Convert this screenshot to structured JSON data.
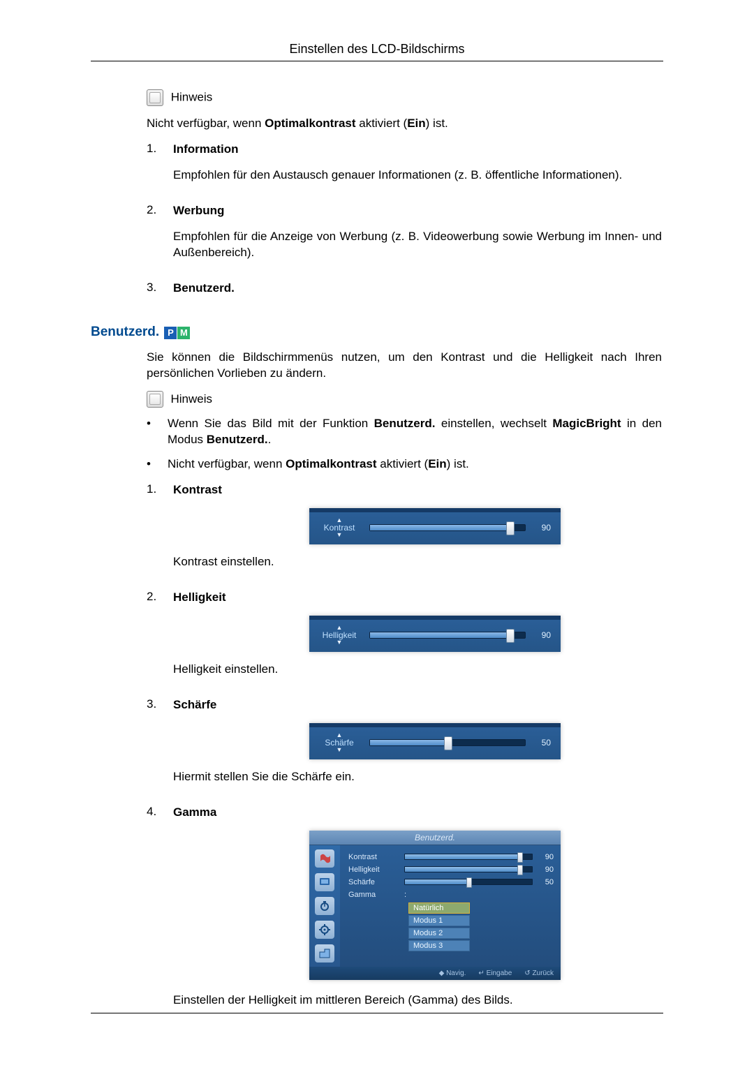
{
  "header": {
    "title": "Einstellen des LCD-Bildschirms"
  },
  "hinweis_label": "Hinweis",
  "top_note_text_pre": "Nicht verfügbar, wenn ",
  "top_note_bold1": "Optimalkontrast",
  "top_note_text_mid": " aktiviert (",
  "top_note_bold2": "Ein",
  "top_note_text_end": ") ist.",
  "top_list": {
    "i1": {
      "num": "1.",
      "title": "Information",
      "desc": "Empfohlen für den Austausch genauer Informationen (z. B. öffentliche Informationen)."
    },
    "i2": {
      "num": "2.",
      "title": "Werbung",
      "desc": "Empfohlen für die Anzeige von Werbung (z. B. Videowerbung sowie Werbung im Innen- und Außenbereich)."
    },
    "i3": {
      "num": "3.",
      "title": "Benutzerd."
    }
  },
  "section": {
    "title": "Benutzerd.",
    "intro": "Sie können die Bildschirmmenüs nutzen, um den Kontrast und die Helligkeit nach Ihren persönlichen Vorlieben zu ändern.",
    "bullet1_pre": "Wenn Sie das Bild mit der Funktion ",
    "bullet1_b1": "Benutzerd.",
    "bullet1_mid": " einstellen, wechselt ",
    "bullet1_b2": "MagicBright",
    "bullet1_mid2": " in den Modus ",
    "bullet1_b3": "Benutzerd.",
    "bullet1_end": ".",
    "bullet2_pre": "Nicht verfügbar, wenn ",
    "bullet2_b1": "Optimalkontrast",
    "bullet2_mid": " aktiviert (",
    "bullet2_b2": "Ein",
    "bullet2_end": ") ist.",
    "items": {
      "kontrast": {
        "num": "1.",
        "title": "Kontrast",
        "slider_label": "Kontrast",
        "value": "90",
        "pct": 90,
        "desc": "Kontrast einstellen."
      },
      "helligkeit": {
        "num": "2.",
        "title": "Helligkeit",
        "slider_label": "Helligkeit",
        "value": "90",
        "pct": 90,
        "desc": "Helligkeit einstellen."
      },
      "schaerfe": {
        "num": "3.",
        "title": "Schärfe",
        "slider_label": "Schärfe",
        "value": "50",
        "pct": 50,
        "desc": "Hiermit stellen Sie die Schärfe ein."
      },
      "gamma": {
        "num": "4.",
        "title": "Gamma",
        "desc": "Einstellen der Helligkeit im mittleren Bereich (Gamma) des Bilds."
      }
    }
  },
  "gamma_menu": {
    "title": "Benutzerd.",
    "rows": {
      "kontrast": {
        "label": "Kontrast",
        "value": "90",
        "pct": 90
      },
      "helligkeit": {
        "label": "Helligkeit",
        "value": "90",
        "pct": 90
      },
      "schaerfe": {
        "label": "Schärfe",
        "value": "50",
        "pct": 50
      },
      "gamma": {
        "label": "Gamma",
        "colon": ":"
      }
    },
    "options": {
      "o0": "Natürlich",
      "o1": "Modus 1",
      "o2": "Modus 2",
      "o3": "Modus 3"
    },
    "footer": {
      "nav": "◆ Navig.",
      "enter": "↵ Eingabe",
      "back": "↺ Zurück"
    }
  }
}
